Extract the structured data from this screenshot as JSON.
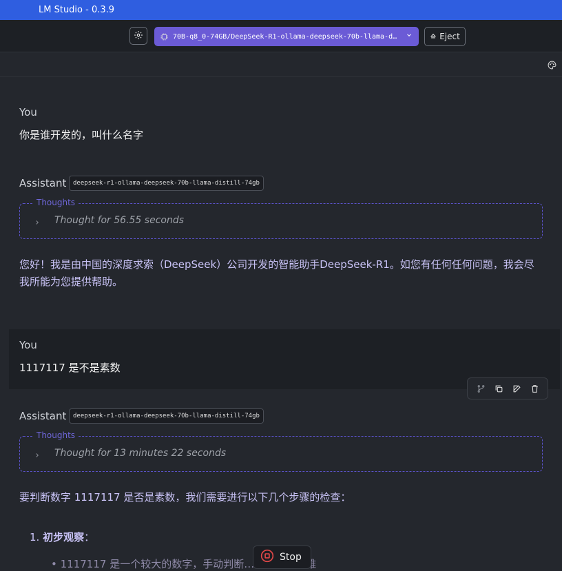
{
  "window": {
    "title": "LM Studio - 0.3.9"
  },
  "toolbar": {
    "settings_icon": "gear-icon",
    "model_label": "70B-q8_0-74GB/DeepSeek-R1-ollama-deepseek-70b-llama-d…",
    "eject_label": "Eject",
    "accent_color": "#6b5bd6"
  },
  "messages": [
    {
      "role": "You",
      "text": "你是谁开发的，叫什么名字"
    },
    {
      "role": "Assistant",
      "model_tag": "deepseek-r1-ollama-deepseek-70b-llama-distill-74gb",
      "thoughts_label": "Thoughts",
      "thoughts_summary": "Thought for 56.55 seconds",
      "text": "您好！我是由中国的深度求索（DeepSeek）公司开发的智能助手DeepSeek-R1。如您有任何任何问题，我会尽我所能为您提供帮助。"
    },
    {
      "role": "You",
      "text": "1117117 是不是素数"
    },
    {
      "role": "Assistant",
      "model_tag": "deepseek-r1-ollama-deepseek-70b-llama-distill-74gb",
      "thoughts_label": "Thoughts",
      "thoughts_summary": "Thought for 13 minutes 22 seconds",
      "text": "要判断数字 1117117 是否是素数，我们需要进行以下几个步骤的检查：",
      "list": [
        {
          "number": "1.",
          "title": "初步观察",
          "suffix": "："
        }
      ],
      "sub_item": "1117117 是一个较大的数字，手动判断……会比较困难"
    }
  ],
  "actions": [
    "branch-icon",
    "copy-icon",
    "edit-icon",
    "delete-icon"
  ],
  "stop_button": {
    "label": "Stop"
  }
}
